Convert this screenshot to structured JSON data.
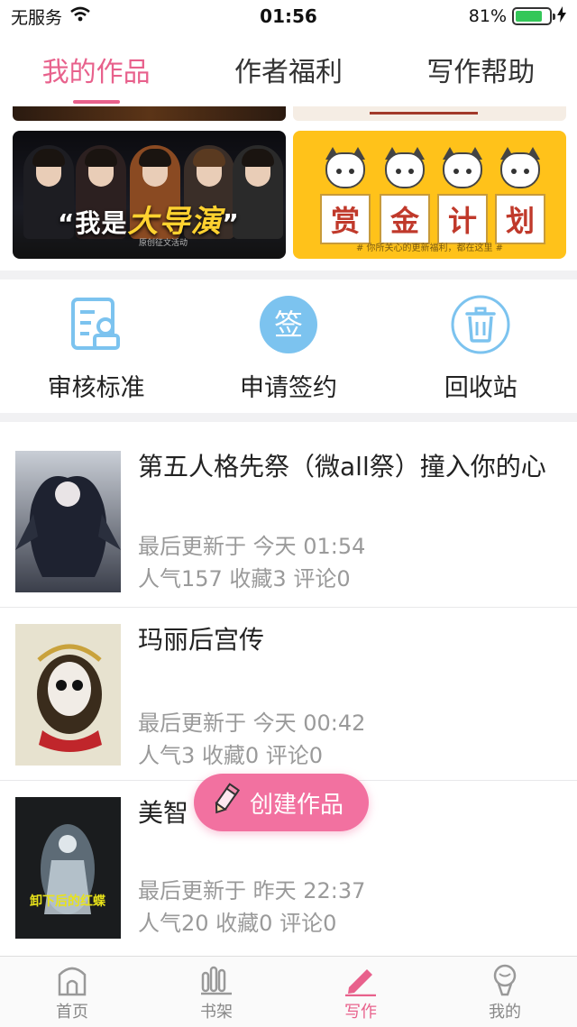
{
  "status_bar": {
    "carrier": "无服务",
    "time": "01:56",
    "battery_percent": "81%",
    "battery_level": 0.81
  },
  "top_tabs": [
    {
      "label": "我的作品",
      "active": true
    },
    {
      "label": "作者福利",
      "active": false
    },
    {
      "label": "写作帮助",
      "active": false
    }
  ],
  "banners": {
    "left": {
      "prefix": "“我是",
      "highlight": "大导演",
      "suffix": "”",
      "subtitle": "原创征文活动"
    },
    "right": {
      "chars": [
        "赏",
        "金",
        "计",
        "划"
      ],
      "footer": "# 你所关心的更新福利，都在这里 #"
    }
  },
  "actions": [
    {
      "label": "审核标准",
      "icon": "review-standard-icon"
    },
    {
      "label": "申请签约",
      "icon": "sign-contract-icon",
      "icon_char": "签"
    },
    {
      "label": "回收站",
      "icon": "trash-icon"
    }
  ],
  "works": [
    {
      "title": "第五人格先祭（微all祭）撞入你的心",
      "updated": "最后更新于 今天 01:54",
      "stats": "人气157 收藏3 评论0"
    },
    {
      "title": "玛丽后宫传",
      "updated": "最后更新于 今天 00:42",
      "stats": "人气3 收藏0 评论0"
    },
    {
      "title": "美智",
      "updated": "最后更新于 昨天 22:37",
      "stats": "人气20 收藏0 评论0",
      "cover_text": "卸下后的红蝶"
    }
  ],
  "create_button": {
    "label": "创建作品"
  },
  "bottom_nav": [
    {
      "label": "首页",
      "icon": "home-icon",
      "active": false
    },
    {
      "label": "书架",
      "icon": "bookshelf-icon",
      "active": false
    },
    {
      "label": "写作",
      "icon": "pencil-icon",
      "active": true
    },
    {
      "label": "我的",
      "icon": "profile-icon",
      "active": false
    }
  ],
  "colors": {
    "accent": "#e8618c",
    "create_button": "#f271a0",
    "action_blue": "#7cc3ef"
  }
}
